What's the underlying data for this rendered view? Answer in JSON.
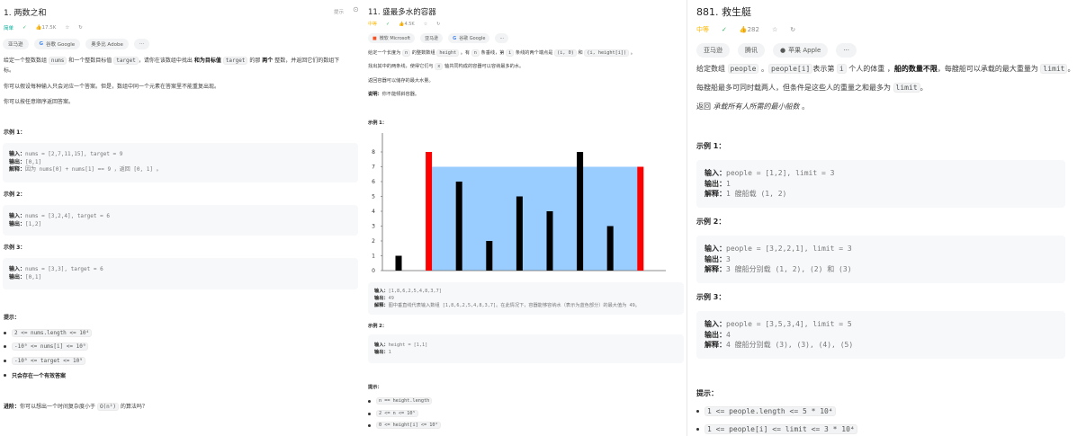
{
  "p1": {
    "title": "1. 两数之和",
    "hint": "提示",
    "difficulty": "简单",
    "likes": "17.5K",
    "tags": [
      "亚马逊",
      "谷歌 Google",
      "奥多比 Adobe",
      "···"
    ],
    "paras": [
      [
        {
          "t": "给定一个整数数组 "
        },
        {
          "c": "nums"
        },
        {
          "t": " 和一个整数目标值 "
        },
        {
          "c": "target"
        },
        {
          "t": "，请你在该数组中找出 "
        },
        {
          "b": "和为目标值"
        },
        {
          "t": " "
        },
        {
          "c": "target"
        },
        {
          "t": " 的那 "
        },
        {
          "b": "两个"
        },
        {
          "t": " 整数，并返回它们的数组下"
        }
      ],
      [
        {
          "t": "标。"
        }
      ],
      [
        {
          "t": "你可以假设每种输入只会对应一个答案。但是，数组中同一个元素在答案里不能重复出现。"
        }
      ],
      [
        {
          "t": "你可以按任意顺序返回答案。"
        }
      ]
    ],
    "examples": [
      {
        "heading": "示例 1：",
        "lines": [
          {
            "label": "输入：",
            "value": "nums = [2,7,11,15], target = 9"
          },
          {
            "label": "输出：",
            "value": "[0,1]"
          },
          {
            "label": "解释：",
            "value": "因为 nums[0] + nums[1] == 9 ，返回 [0, 1] 。"
          }
        ]
      },
      {
        "heading": "示例 2：",
        "lines": [
          {
            "label": "输入：",
            "value": "nums = [3,2,4], target = 6"
          },
          {
            "label": "输出：",
            "value": "[1,2]"
          }
        ]
      },
      {
        "heading": "示例 3：",
        "lines": [
          {
            "label": "输入：",
            "value": "nums = [3,3], target = 6"
          },
          {
            "label": "输出：",
            "value": "[0,1]"
          }
        ]
      }
    ],
    "constraints_heading": "提示：",
    "constraints": [
      "2 <= nums.length <= 10⁴",
      "-10⁹ <= nums[i] <= 10⁹",
      "-10⁹ <= target <= 10⁹"
    ],
    "constraint_bold": "只会存在一个有效答案",
    "followup": [
      {
        "b": "进阶："
      },
      {
        "t": "你可以想出一个时间复杂度小于 "
      },
      {
        "c": "O(n²)"
      },
      {
        "t": " 的算法吗？"
      }
    ]
  },
  "p2": {
    "title": "11. 盛最多水的容器",
    "difficulty": "中等",
    "likes": "4.5K",
    "tags": [
      "微软 Microsoft",
      "亚马逊",
      "谷歌 Google",
      "···"
    ],
    "paras": [
      [
        {
          "t": "给定一个长度为 "
        },
        {
          "c": "n"
        },
        {
          "t": " 的整数数组 "
        },
        {
          "c": "height"
        },
        {
          "t": " 。有 "
        },
        {
          "c": "n"
        },
        {
          "t": " 条垂线，第 "
        },
        {
          "c": "i"
        },
        {
          "t": " 条线的两个端点是 "
        },
        {
          "c": "(i, 0)"
        },
        {
          "t": " 和 "
        },
        {
          "c": "(i, height[i])"
        },
        {
          "t": " 。"
        }
      ],
      [
        {
          "t": "找出其中的两条线，使得它们与 "
        },
        {
          "c": "x"
        },
        {
          "t": " 轴共同构成的容器可以容纳最多的水。"
        }
      ],
      [
        {
          "t": "返回容器可以储存的最大水量。"
        }
      ],
      [
        {
          "b": "说明："
        },
        {
          "t": "你不能倾斜容器。"
        }
      ]
    ],
    "ex1_heading": "示例 1：",
    "ex1_lines": [
      {
        "label": "输入：",
        "value": "[1,8,6,2,5,4,8,3,7]"
      },
      {
        "label": "输出：",
        "value": "49"
      },
      {
        "label": "解释：",
        "value": "图中垂直线代表输入数组 [1,8,6,2,5,4,8,3,7]。在此情况下，容器能够容纳水（表示为蓝色部分）的最大值为 49。"
      }
    ],
    "ex2_heading": "示例 2：",
    "ex2_lines": [
      {
        "label": "输入：",
        "value": "height = [1,1]"
      },
      {
        "label": "输出：",
        "value": "1"
      }
    ],
    "constraints_heading": "提示：",
    "constraints": [
      "n == height.length",
      "2 <= n <= 10⁵",
      "0 <= height[i] <= 10⁴"
    ]
  },
  "p3": {
    "title": "881. 救生艇",
    "difficulty": "中等",
    "likes": "282",
    "tags": [
      "亚马逊",
      "腾讯",
      "苹果 Apple",
      "···"
    ],
    "paras": [
      [
        {
          "t": "给定数组 "
        },
        {
          "c": "people"
        },
        {
          "t": " 。"
        },
        {
          "c": "people[i]"
        },
        {
          "t": "表示第 "
        },
        {
          "c": "i"
        },
        {
          "t": " 个人的体重 ，"
        },
        {
          "b": "船的数量不限"
        },
        {
          "t": "，每艘船可以承载的最大重量为 "
        },
        {
          "c": "limit"
        },
        {
          "t": "。"
        }
      ],
      [
        {
          "t": "每艘船最多可同时载两人，但条件是这些人的重量之和最多为 "
        },
        {
          "c": "limit"
        },
        {
          "t": "。"
        }
      ],
      [
        {
          "t": "返回 "
        },
        {
          "i": "承载所有人所需的最小船数"
        },
        {
          "t": " 。"
        }
      ]
    ],
    "examples": [
      {
        "heading": "示例 1：",
        "lines": [
          {
            "label": "输入：",
            "value": "people = [1,2], limit = 3"
          },
          {
            "label": "输出：",
            "value": "1"
          },
          {
            "label": "解释：",
            "value": "1 艘船载 (1, 2)"
          }
        ]
      },
      {
        "heading": "示例 2：",
        "lines": [
          {
            "label": "输入：",
            "value": "people = [3,2,2,1], limit = 3"
          },
          {
            "label": "输出：",
            "value": "3"
          },
          {
            "label": "解释：",
            "value": "3 艘船分别载 (1, 2), (2) 和 (3)"
          }
        ]
      },
      {
        "heading": "示例 3：",
        "lines": [
          {
            "label": "输入：",
            "value": "people = [3,5,3,4], limit = 5"
          },
          {
            "label": "输出：",
            "value": "4"
          },
          {
            "label": "解释：",
            "value": "4 艘船分别载 (3), (3), (4), (5)"
          }
        ]
      }
    ],
    "constraints_heading": "提示：",
    "constraints": [
      "1 <= people.length <= 5 * 10⁴",
      "1 <= people[i] <= limit <= 3 * 10⁴"
    ]
  },
  "chart_data": {
    "type": "bar",
    "values": [
      1,
      8,
      6,
      2,
      5,
      4,
      8,
      3,
      7
    ],
    "highlight": [
      1,
      8
    ],
    "water_level": 7,
    "yticks": [
      "0",
      "1",
      "2",
      "3",
      "4",
      "5",
      "6",
      "7",
      "8"
    ],
    "ylim": [
      0,
      8
    ],
    "colors": {
      "bar": "#000000",
      "highlight": "#ff0000",
      "water": "#99ccff"
    }
  }
}
